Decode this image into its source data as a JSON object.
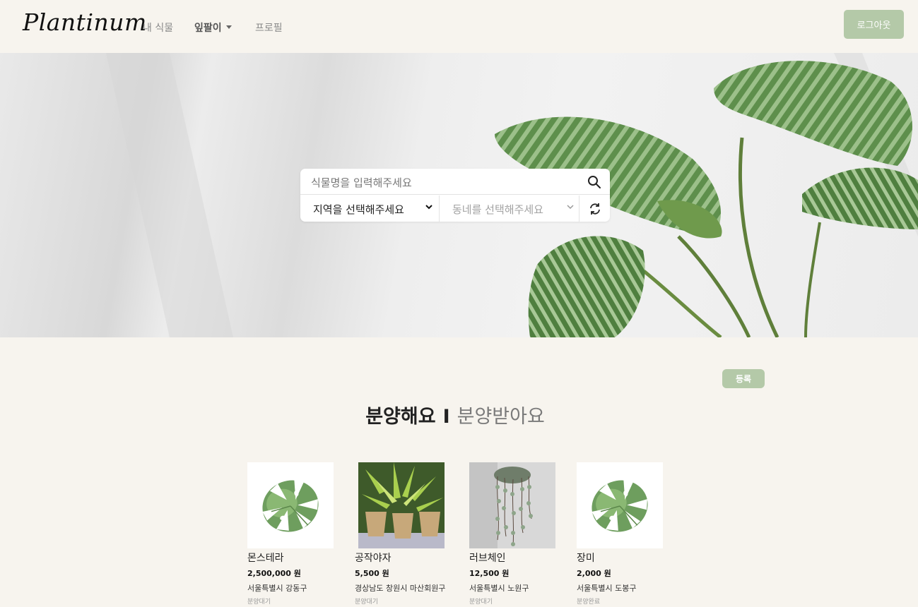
{
  "navbar": {
    "logo": "Plantinum",
    "links": [
      {
        "label": "내 식물"
      },
      {
        "label": "잎팔이"
      },
      {
        "label": "프로필"
      }
    ],
    "logout_label": "로그아웃"
  },
  "search": {
    "placeholder": "식물명을 입력해주세요",
    "region_select": "지역을 선택해주세요",
    "town_select": "동네를 선택해주세요"
  },
  "content": {
    "register_label": "등록",
    "tab_sell": "분양해요",
    "tab_separator": "I",
    "tab_adopt": "분양받아요"
  },
  "listings": [
    {
      "name": "몬스테라",
      "price": "2,500,000 원",
      "location": "서울특별시 강동구",
      "status": "분양대기",
      "image_icon": "monstera-leaf-icon"
    },
    {
      "name": "공작야자",
      "price": "5,500 원",
      "location": "경상남도 창원시 마산회원구",
      "status": "분양대기",
      "image_icon": "fern-photo"
    },
    {
      "name": "러브체인",
      "price": "12,500 원",
      "location": "서울특별시 노원구",
      "status": "분양대기",
      "image_icon": "string-of-hearts-photo"
    },
    {
      "name": "장미",
      "price": "2,000 원",
      "location": "서울특별시 도봉구",
      "status": "분양완료",
      "image_icon": "monstera-leaf-icon"
    }
  ],
  "colors": {
    "accent": "#b4c9a8",
    "background": "#f7f4ee"
  }
}
